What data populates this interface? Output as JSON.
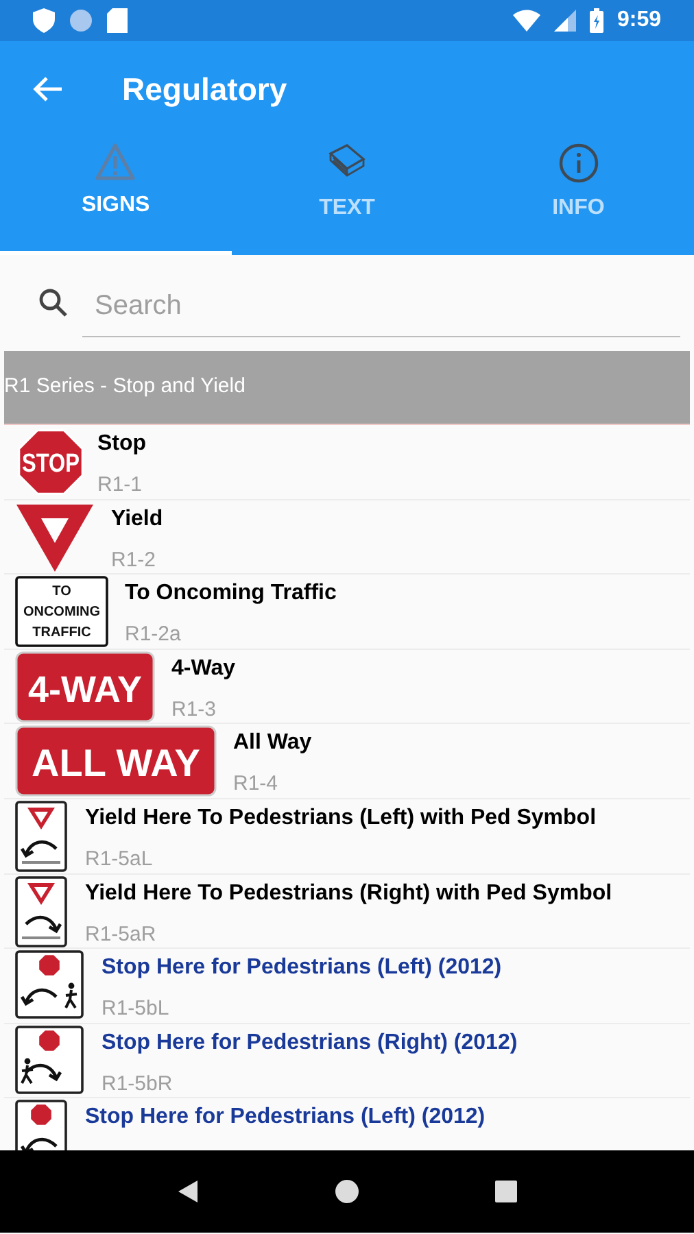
{
  "status_bar": {
    "time": "9:59"
  },
  "app_bar": {
    "title": "Regulatory"
  },
  "tabs": [
    {
      "label": "SIGNS",
      "kind": "warning",
      "selected": true
    },
    {
      "label": "TEXT",
      "kind": "book",
      "selected": false
    },
    {
      "label": "INFO",
      "kind": "info",
      "selected": false
    }
  ],
  "search": {
    "placeholder": "Search"
  },
  "section": {
    "title": "R1 Series - Stop and Yield"
  },
  "rows": [
    {
      "title": "Stop",
      "code": "R1-1",
      "color": "#000000",
      "sign": {
        "kind": "stop",
        "legend": [
          "STOP"
        ]
      }
    },
    {
      "title": "Yield",
      "code": "R1-2",
      "color": "#000000",
      "sign": {
        "kind": "yield"
      }
    },
    {
      "title": "To Oncoming Traffic",
      "code": "R1-2a",
      "color": "#000000",
      "sign": {
        "kind": "plaque",
        "legend": [
          "TO",
          "ONCOMING",
          "TRAFFIC"
        ]
      }
    },
    {
      "title": "4-Way",
      "code": "R1-3",
      "color": "#000000",
      "sign": {
        "kind": "plate",
        "legend": [
          "4-WAY"
        ]
      }
    },
    {
      "title": "All Way",
      "code": "R1-4",
      "color": "#000000",
      "sign": {
        "kind": "plate_wide",
        "legend": [
          "ALL WAY"
        ]
      }
    },
    {
      "title": "Yield Here To Pedestrians (Left) with Ped Symbol",
      "code": "R1-5aL",
      "color": "#000000",
      "sign": {
        "kind": "yield_here_left"
      }
    },
    {
      "title": "Yield Here To Pedestrians (Right) with Ped Symbol",
      "code": "R1-5aR",
      "color": "#000000",
      "sign": {
        "kind": "yield_here_right"
      }
    },
    {
      "title": "Stop Here for Pedestrians (Left) (2012)",
      "code": "R1-5bL",
      "color": "#1a3a9a",
      "sign": {
        "kind": "stop_here_left"
      }
    },
    {
      "title": "Stop Here for Pedestrians (Right) (2012)",
      "code": "R1-5bR",
      "color": "#1a3a9a",
      "sign": {
        "kind": "stop_here_right"
      }
    },
    {
      "title": "Stop Here for Pedestrians (Left) (2012)",
      "color": "#1a3a9a",
      "sign": {
        "kind": "stop_here_narrow"
      }
    }
  ]
}
